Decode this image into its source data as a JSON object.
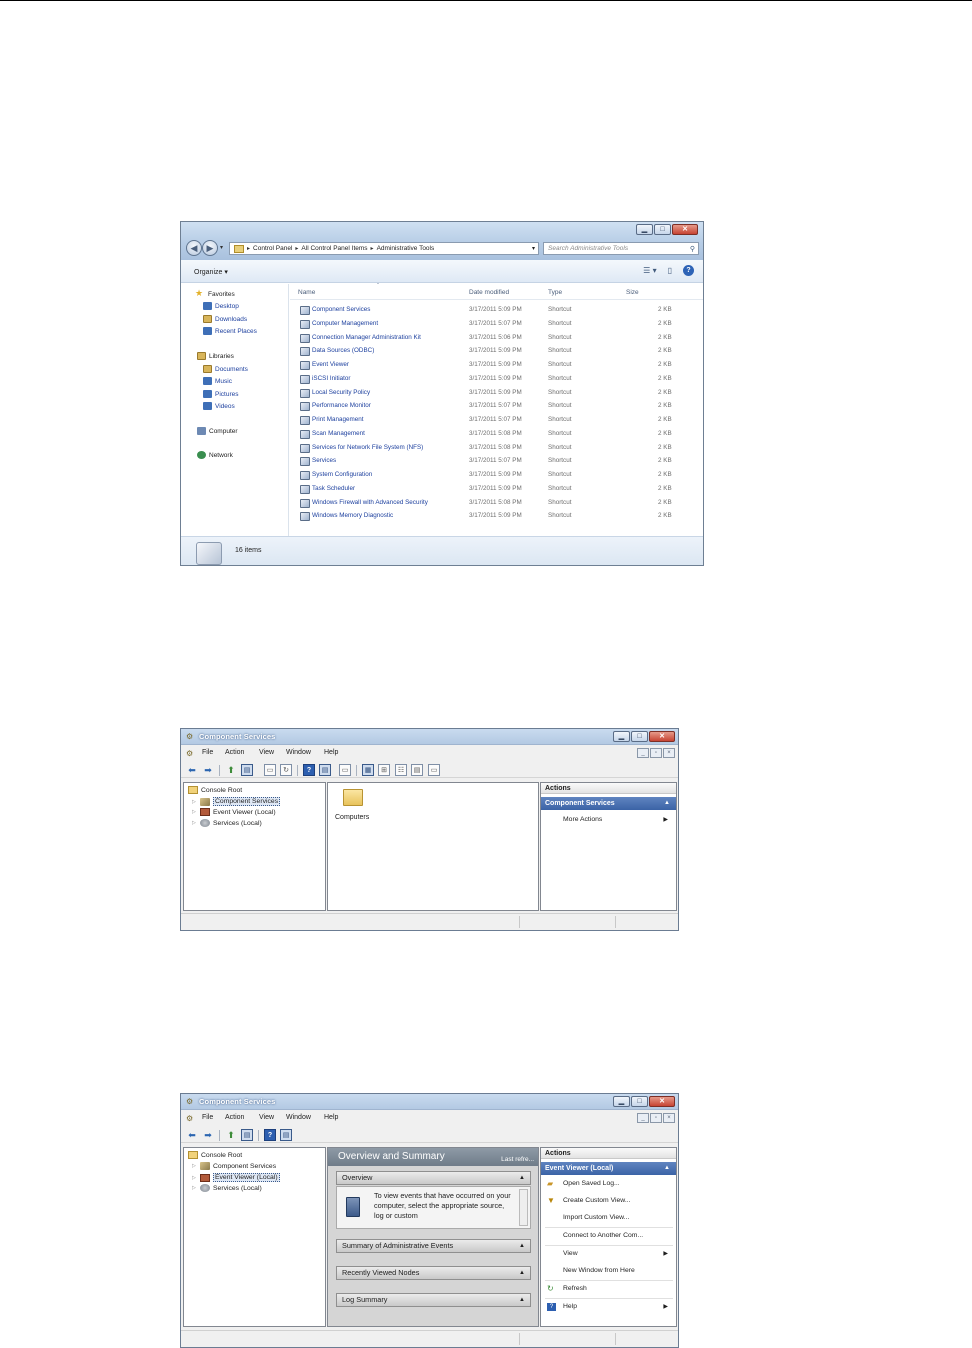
{
  "explorer": {
    "breadcrumb": [
      "Control Panel",
      "All Control Panel Items",
      "Administrative Tools"
    ],
    "search_placeholder": "Search Administrative Tools",
    "organize_label": "Organize ▾",
    "nav": {
      "favorites": "Favorites",
      "favorites_items": [
        "Desktop",
        "Downloads",
        "Recent Places"
      ],
      "libraries": "Libraries",
      "libraries_items": [
        "Documents",
        "Music",
        "Pictures",
        "Videos"
      ],
      "computer": "Computer",
      "network": "Network"
    },
    "columns": {
      "name": "Name",
      "date": "Date modified",
      "type": "Type",
      "size": "Size"
    },
    "files": [
      {
        "name": "Component Services",
        "date": "3/17/2011 5:09 PM",
        "type": "Shortcut",
        "size": "2 KB"
      },
      {
        "name": "Computer Management",
        "date": "3/17/2011 5:07 PM",
        "type": "Shortcut",
        "size": "2 KB"
      },
      {
        "name": "Connection Manager Administration Kit",
        "date": "3/17/2011 5:06 PM",
        "type": "Shortcut",
        "size": "2 KB"
      },
      {
        "name": "Data Sources (ODBC)",
        "date": "3/17/2011 5:09 PM",
        "type": "Shortcut",
        "size": "2 KB"
      },
      {
        "name": "Event Viewer",
        "date": "3/17/2011 5:09 PM",
        "type": "Shortcut",
        "size": "2 KB"
      },
      {
        "name": "iSCSI Initiator",
        "date": "3/17/2011 5:09 PM",
        "type": "Shortcut",
        "size": "2 KB"
      },
      {
        "name": "Local Security Policy",
        "date": "3/17/2011 5:09 PM",
        "type": "Shortcut",
        "size": "2 KB"
      },
      {
        "name": "Performance Monitor",
        "date": "3/17/2011 5:07 PM",
        "type": "Shortcut",
        "size": "2 KB"
      },
      {
        "name": "Print Management",
        "date": "3/17/2011 5:07 PM",
        "type": "Shortcut",
        "size": "2 KB"
      },
      {
        "name": "Scan Management",
        "date": "3/17/2011 5:08 PM",
        "type": "Shortcut",
        "size": "2 KB"
      },
      {
        "name": "Services for Network File System (NFS)",
        "date": "3/17/2011 5:08 PM",
        "type": "Shortcut",
        "size": "2 KB"
      },
      {
        "name": "Services",
        "date": "3/17/2011 5:07 PM",
        "type": "Shortcut",
        "size": "2 KB"
      },
      {
        "name": "System Configuration",
        "date": "3/17/2011 5:09 PM",
        "type": "Shortcut",
        "size": "2 KB"
      },
      {
        "name": "Task Scheduler",
        "date": "3/17/2011 5:09 PM",
        "type": "Shortcut",
        "size": "2 KB"
      },
      {
        "name": "Windows Firewall with Advanced Security",
        "date": "3/17/2011 5:08 PM",
        "type": "Shortcut",
        "size": "2 KB"
      },
      {
        "name": "Windows Memory Diagnostic",
        "date": "3/17/2011 5:09 PM",
        "type": "Shortcut",
        "size": "2 KB"
      }
    ],
    "status_count": "16 items"
  },
  "mmc1": {
    "title": "Component Services",
    "menu": [
      "File",
      "Action",
      "View",
      "Window",
      "Help"
    ],
    "tree": {
      "root": "Console Root",
      "items": [
        "Component Services",
        "Event Viewer (Local)",
        "Services (Local)"
      ]
    },
    "center_item": "Computers",
    "actions": {
      "header": "Actions",
      "section": "Component Services",
      "items": [
        "More Actions"
      ]
    }
  },
  "mmc2": {
    "title": "Component Services",
    "menu": [
      "File",
      "Action",
      "View",
      "Window",
      "Help"
    ],
    "tree": {
      "root": "Console Root",
      "items": [
        "Component Services",
        "Event Viewer (Local)",
        "Services (Local)"
      ]
    },
    "overview": {
      "title": "Overview and Summary",
      "last_refresh": "Last refre...",
      "section_overview": "Overview",
      "overview_text": "To view events that have occurred on your computer, select the appropriate source, log or custom",
      "sections": [
        "Summary of Administrative Events",
        "Recently Viewed Nodes",
        "Log Summary"
      ]
    },
    "actions": {
      "header": "Actions",
      "section": "Event Viewer (Local)",
      "items": [
        "Open Saved Log...",
        "Create Custom View...",
        "Import Custom View...",
        "Connect to Another Com...",
        "View",
        "New Window from Here",
        "Refresh",
        "Help"
      ]
    }
  },
  "colors": {
    "link_blue": "#1c3f9e",
    "action_header": "#3b63a6",
    "overview_header": "#7a8794"
  }
}
